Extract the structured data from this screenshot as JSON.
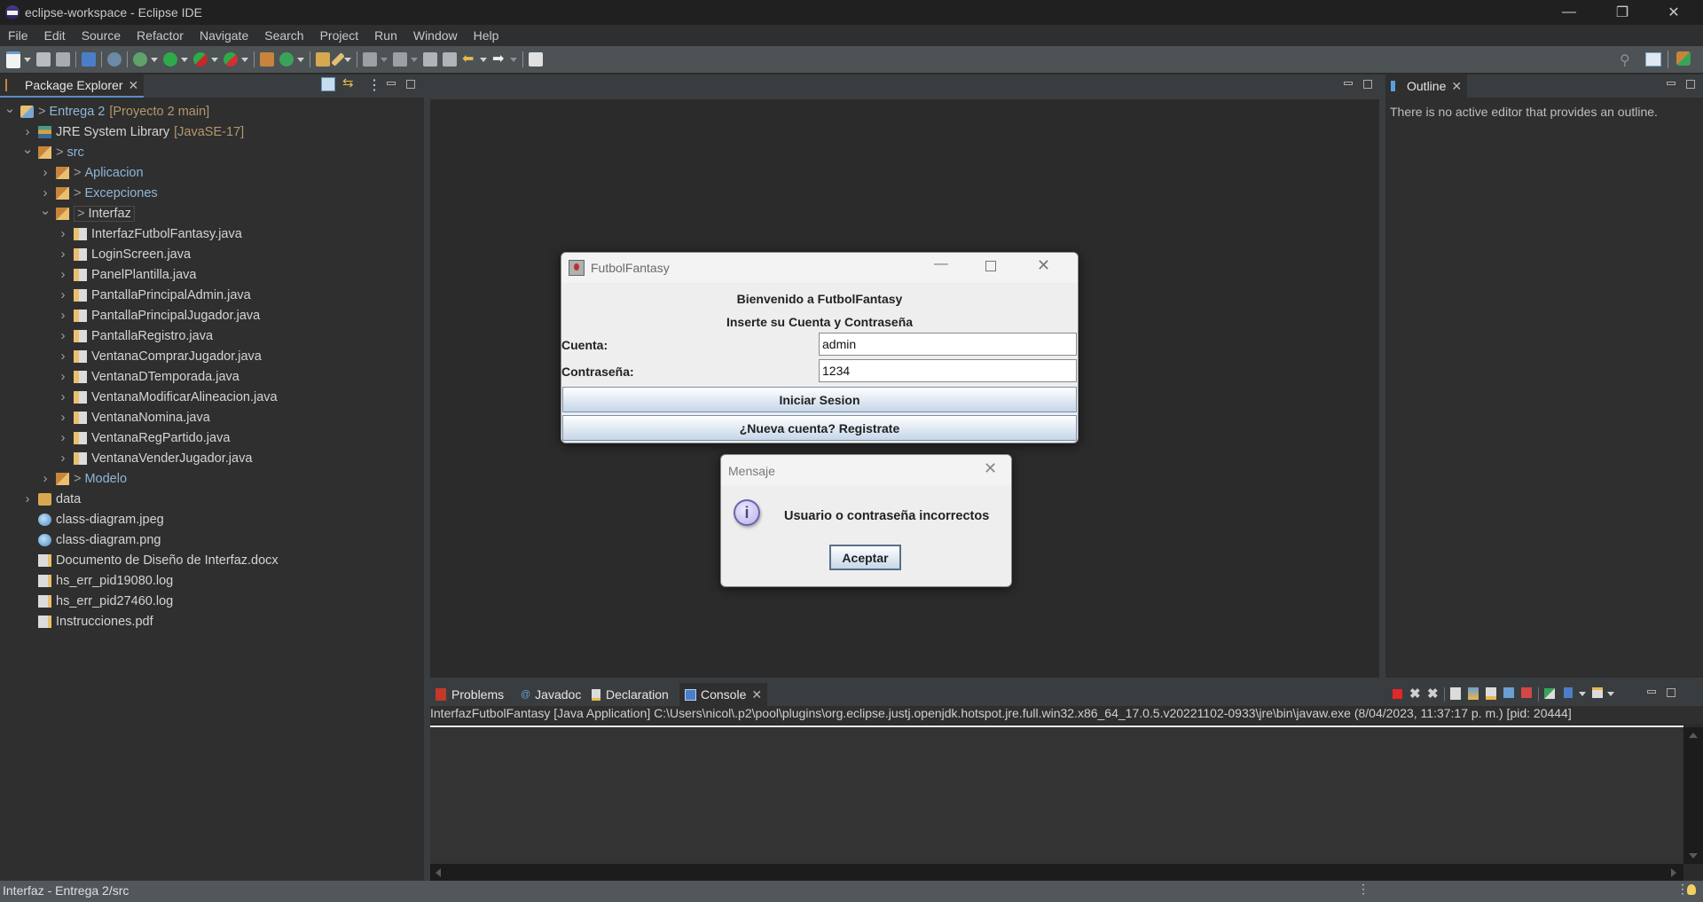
{
  "window": {
    "title": "eclipse-workspace - Eclipse IDE",
    "controls": {
      "minimize": "—",
      "restore": "❐",
      "close": "✕"
    }
  },
  "menubar": [
    "File",
    "Edit",
    "Source",
    "Refactor",
    "Navigate",
    "Search",
    "Project",
    "Run",
    "Window",
    "Help"
  ],
  "package_explorer": {
    "tab_label": "Package Explorer",
    "tree": [
      {
        "label": "Entrega 2",
        "prefix": ">",
        "decoration": "[Proyecto 2 main]",
        "level": 0,
        "expanded": true,
        "icon": "project-icon"
      },
      {
        "label": "JRE System Library",
        "decoration": "[JavaSE-17]",
        "level": 1,
        "expanded": false,
        "icon": "library-icon"
      },
      {
        "label": "src",
        "prefix": ">",
        "level": 1,
        "expanded": true,
        "icon": "source-folder-icon"
      },
      {
        "label": "Aplicacion",
        "prefix": ">",
        "level": 2,
        "expanded": false,
        "icon": "package-icon"
      },
      {
        "label": "Excepciones",
        "prefix": ">",
        "level": 2,
        "expanded": false,
        "icon": "package-icon"
      },
      {
        "label": "Interfaz",
        "prefix": ">",
        "level": 2,
        "expanded": true,
        "icon": "package-icon",
        "selected": true
      },
      {
        "label": "InterfazFutbolFantasy.java",
        "level": 3,
        "expanded": false,
        "icon": "java-file-icon"
      },
      {
        "label": "LoginScreen.java",
        "level": 3,
        "expanded": false,
        "icon": "java-file-icon"
      },
      {
        "label": "PanelPlantilla.java",
        "level": 3,
        "expanded": false,
        "icon": "java-file-icon"
      },
      {
        "label": "PantallaPrincipalAdmin.java",
        "level": 3,
        "expanded": false,
        "icon": "java-file-icon"
      },
      {
        "label": "PantallaPrincipalJugador.java",
        "level": 3,
        "expanded": false,
        "icon": "java-file-icon"
      },
      {
        "label": "PantallaRegistro.java",
        "level": 3,
        "expanded": false,
        "icon": "java-file-icon"
      },
      {
        "label": "VentanaComprarJugador.java",
        "level": 3,
        "expanded": false,
        "icon": "java-file-icon"
      },
      {
        "label": "VentanaDTemporada.java",
        "level": 3,
        "expanded": false,
        "icon": "java-file-icon"
      },
      {
        "label": "VentanaModificarAlineacion.java",
        "level": 3,
        "expanded": false,
        "icon": "java-file-icon"
      },
      {
        "label": "VentanaNomina.java",
        "level": 3,
        "expanded": false,
        "icon": "java-file-icon"
      },
      {
        "label": "VentanaRegPartido.java",
        "level": 3,
        "expanded": false,
        "icon": "java-file-icon"
      },
      {
        "label": "VentanaVenderJugador.java",
        "level": 3,
        "expanded": false,
        "icon": "java-file-icon"
      },
      {
        "label": "Modelo",
        "prefix": ">",
        "level": 2,
        "expanded": false,
        "icon": "package-icon"
      },
      {
        "label": "data",
        "level": 1,
        "expanded": false,
        "icon": "folder-icon"
      },
      {
        "label": "class-diagram.jpeg",
        "level": 1,
        "icon": "image-file-icon"
      },
      {
        "label": "class-diagram.png",
        "level": 1,
        "icon": "image-file-icon"
      },
      {
        "label": "Documento de Diseño de Interfaz.docx",
        "level": 1,
        "icon": "text-file-icon"
      },
      {
        "label": "hs_err_pid19080.log",
        "level": 1,
        "icon": "text-file-icon"
      },
      {
        "label": "hs_err_pid27460.log",
        "level": 1,
        "icon": "text-file-icon"
      },
      {
        "label": "Instrucciones.pdf",
        "level": 1,
        "icon": "text-file-icon"
      }
    ]
  },
  "outline": {
    "tab_label": "Outline",
    "message": "There is no active editor that provides an outline."
  },
  "login_window": {
    "title": "FutbolFantasy",
    "welcome": "Bienvenido a FutbolFantasy",
    "subtitle": "Inserte su Cuenta y Contraseña",
    "account_label": "Cuenta:",
    "account_value": "admin",
    "password_label": "Contraseña:",
    "password_value": "1234",
    "login_button": "Iniciar Sesion",
    "register_button": "¿Nueva cuenta? Registrate"
  },
  "message_dialog": {
    "title": "Mensaje",
    "message": "Usuario o contraseña incorrectos",
    "ok_button": "Aceptar"
  },
  "bottom_panel": {
    "tabs": [
      {
        "label": "Problems",
        "icon": "problems-icon"
      },
      {
        "label": "Javadoc",
        "icon": "javadoc-icon"
      },
      {
        "label": "Declaration",
        "icon": "declaration-icon"
      },
      {
        "label": "Console",
        "icon": "console-icon",
        "active": true
      }
    ],
    "console_header": "InterfazFutbolFantasy [Java Application] C:\\Users\\nicol\\.p2\\pool\\plugins\\org.eclipse.justj.openjdk.hotspot.jre.full.win32.x86_64_17.0.5.v20221102-0933\\jre\\bin\\javaw.exe  (8/04/2023, 11:37:17 p. m.) [pid: 20444]"
  },
  "statusbar": {
    "text": "Interfaz - Entrega 2/src"
  }
}
